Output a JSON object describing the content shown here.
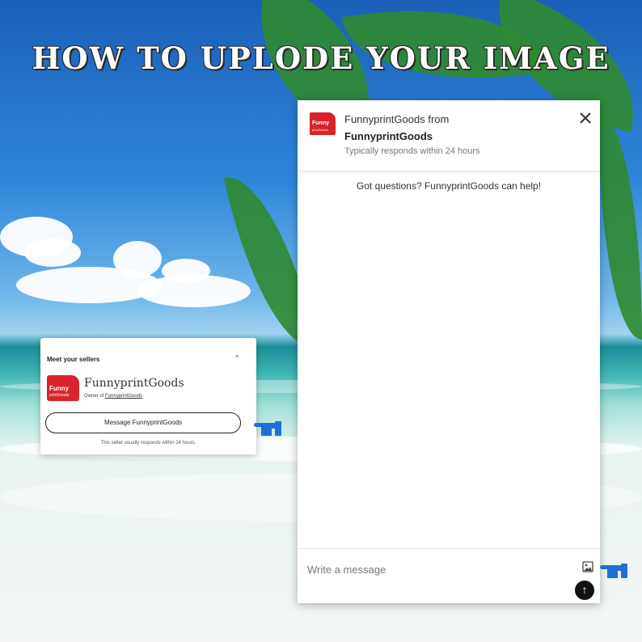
{
  "headline": "HOW TO UPLODE YOUR IMAGE",
  "seller_card": {
    "heading": "Meet your sellers",
    "caret": "^",
    "logo_text": "Funny",
    "logo_subtext": "printGoods",
    "shop_name": "FunnyprintGoods",
    "owner_prefix": "Owner of ",
    "owner_link": "FunnyprintGoods",
    "message_button": "Message FunnyprintGoods",
    "response_note": "This seller usually responds within 24 hours."
  },
  "chat": {
    "logo_text": "Funny",
    "logo_subtext": "printGoods",
    "from_line": "FunnyprintGoods from",
    "shop_name": "FunnyprintGoods",
    "response_time": "Typically responds within 24 hours",
    "intro": "Got questions? FunnyprintGoods can help!",
    "input_placeholder": "Write a message",
    "send_glyph": "↑"
  },
  "colors": {
    "brand_red": "#d8232a",
    "pointer_blue": "#1f6fd6",
    "send_button": "#111111"
  },
  "icons": [
    "close-icon",
    "image-upload-icon",
    "send-arrow-icon",
    "hand-pointer-icon",
    "chevron-up-icon"
  ]
}
